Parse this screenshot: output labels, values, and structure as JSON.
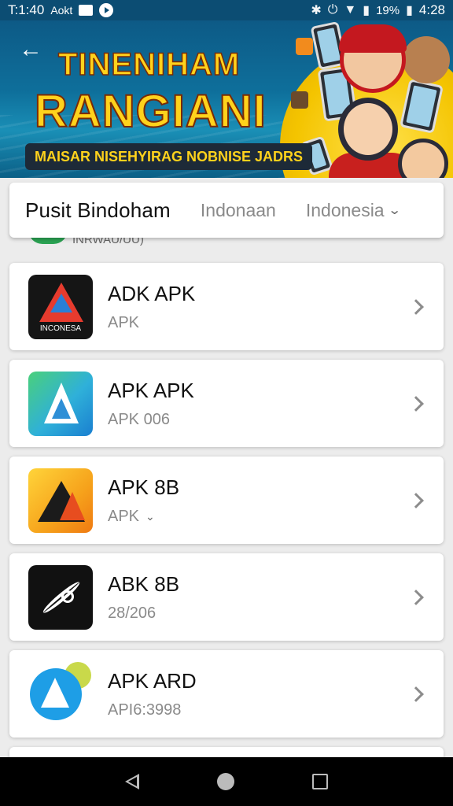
{
  "status_bar": {
    "time_left": "T:1:40",
    "carrier": "Aokt",
    "battery": "19%",
    "clock": "4:28"
  },
  "banner": {
    "title_line1": "TINENIHAM",
    "title_line2": "RANGIANI",
    "tagline": "MAISAR NISEHYIRAG NOBNISE JADRS"
  },
  "filter": {
    "title": "Pusit Bindoham",
    "option1": "Indonaan",
    "select_label": "Indonesia"
  },
  "peek_row": {
    "text": "INRWAU/UU)"
  },
  "apps": [
    {
      "name": "ADK APK",
      "sub": "APK",
      "icon_label": "INCONESA"
    },
    {
      "name": "APK APK",
      "sub": "APK 006"
    },
    {
      "name": "APK 8B",
      "sub": "APK"
    },
    {
      "name": "ABK 8B",
      "sub": "28/206"
    },
    {
      "name": "APK ARD",
      "sub": "API6:3998"
    }
  ],
  "colors": {
    "status_bar": "#0c4d73",
    "banner_title": "#ffd21c",
    "card_bg": "#ffffff",
    "page_bg": "#ececec",
    "nav_bar": "#000000"
  }
}
